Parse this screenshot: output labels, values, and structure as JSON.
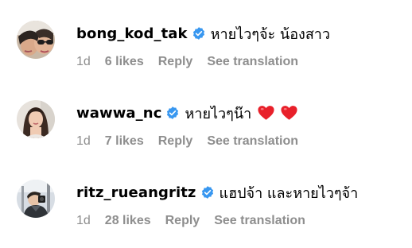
{
  "comments": [
    {
      "username": "bong_kod_tak",
      "text": "หายไวๆจ้ะ น้องสาว",
      "time": "1d",
      "likes": "6 likes",
      "reply": "Reply",
      "translate": "See translation",
      "hearts": 0
    },
    {
      "username": "wawwa_nc",
      "text": "หายไวๆน๊า",
      "time": "1d",
      "likes": "7 likes",
      "reply": "Reply",
      "translate": "See translation",
      "hearts": 2
    },
    {
      "username": "ritz_rueangritz",
      "text": "แฮปจ้า และหายไวๆจ้า",
      "time": "1d",
      "likes": "28 likes",
      "reply": "Reply",
      "translate": "See translation",
      "hearts": 0
    }
  ],
  "colors": {
    "verified": "#3897f0",
    "heart": "#e8202a",
    "secondary_text": "#8e8e8e"
  },
  "icons": {
    "verified": "verified-badge-icon",
    "heart": "red-heart-emoji"
  }
}
